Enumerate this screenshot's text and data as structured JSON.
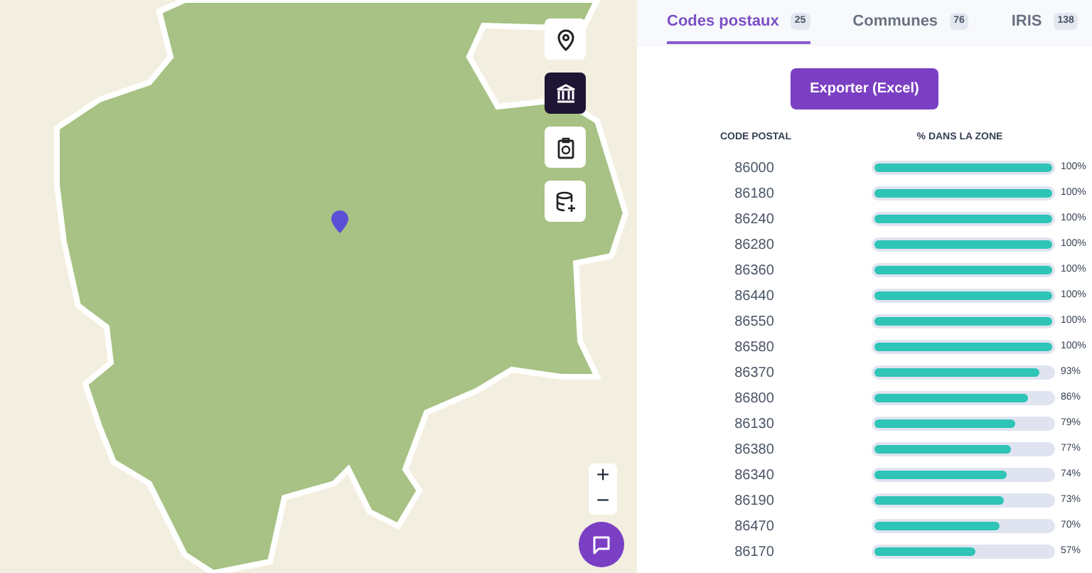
{
  "map": {
    "tools": [
      {
        "kind": "pin",
        "selected": false
      },
      {
        "kind": "building",
        "selected": true
      },
      {
        "kind": "clipboard",
        "selected": false
      },
      {
        "kind": "database",
        "selected": false
      }
    ],
    "zoom": [
      "+",
      "−"
    ]
  },
  "tabs": [
    {
      "label": "Codes postaux",
      "count": "25",
      "selected": true
    },
    {
      "label": "Communes",
      "count": "76",
      "selected": false
    },
    {
      "label": "IRIS",
      "count": "138",
      "selected": false
    }
  ],
  "export_button": "Exporter (Excel)",
  "table": {
    "columns": [
      "CODE POSTAL",
      "% DANS LA ZONE"
    ],
    "rows": [
      {
        "code": "86000",
        "level": 1,
        "percent": "100%"
      },
      {
        "code": "86180",
        "level": 1,
        "percent": "100%"
      },
      {
        "code": "86240",
        "level": 1,
        "percent": "100%"
      },
      {
        "code": "86280",
        "level": 1,
        "percent": "100%"
      },
      {
        "code": "86360",
        "level": 1,
        "percent": "100%"
      },
      {
        "code": "86440",
        "level": 1,
        "percent": "100%"
      },
      {
        "code": "86550",
        "level": 1,
        "percent": "100%"
      },
      {
        "code": "86580",
        "level": 1,
        "percent": "100%"
      },
      {
        "code": "86370",
        "level": 0.93,
        "percent": "93%"
      },
      {
        "code": "86800",
        "level": 0.86,
        "percent": "86%"
      },
      {
        "code": "86130",
        "level": 0.79,
        "percent": "79%"
      },
      {
        "code": "86380",
        "level": 0.77,
        "percent": "77%"
      },
      {
        "code": "86340",
        "level": 0.74,
        "percent": "74%"
      },
      {
        "code": "86190",
        "level": 0.73,
        "percent": "73%"
      },
      {
        "code": "86470",
        "level": 0.7,
        "percent": "70%"
      },
      {
        "code": "86170",
        "level": 0.57,
        "percent": "57%"
      }
    ]
  }
}
